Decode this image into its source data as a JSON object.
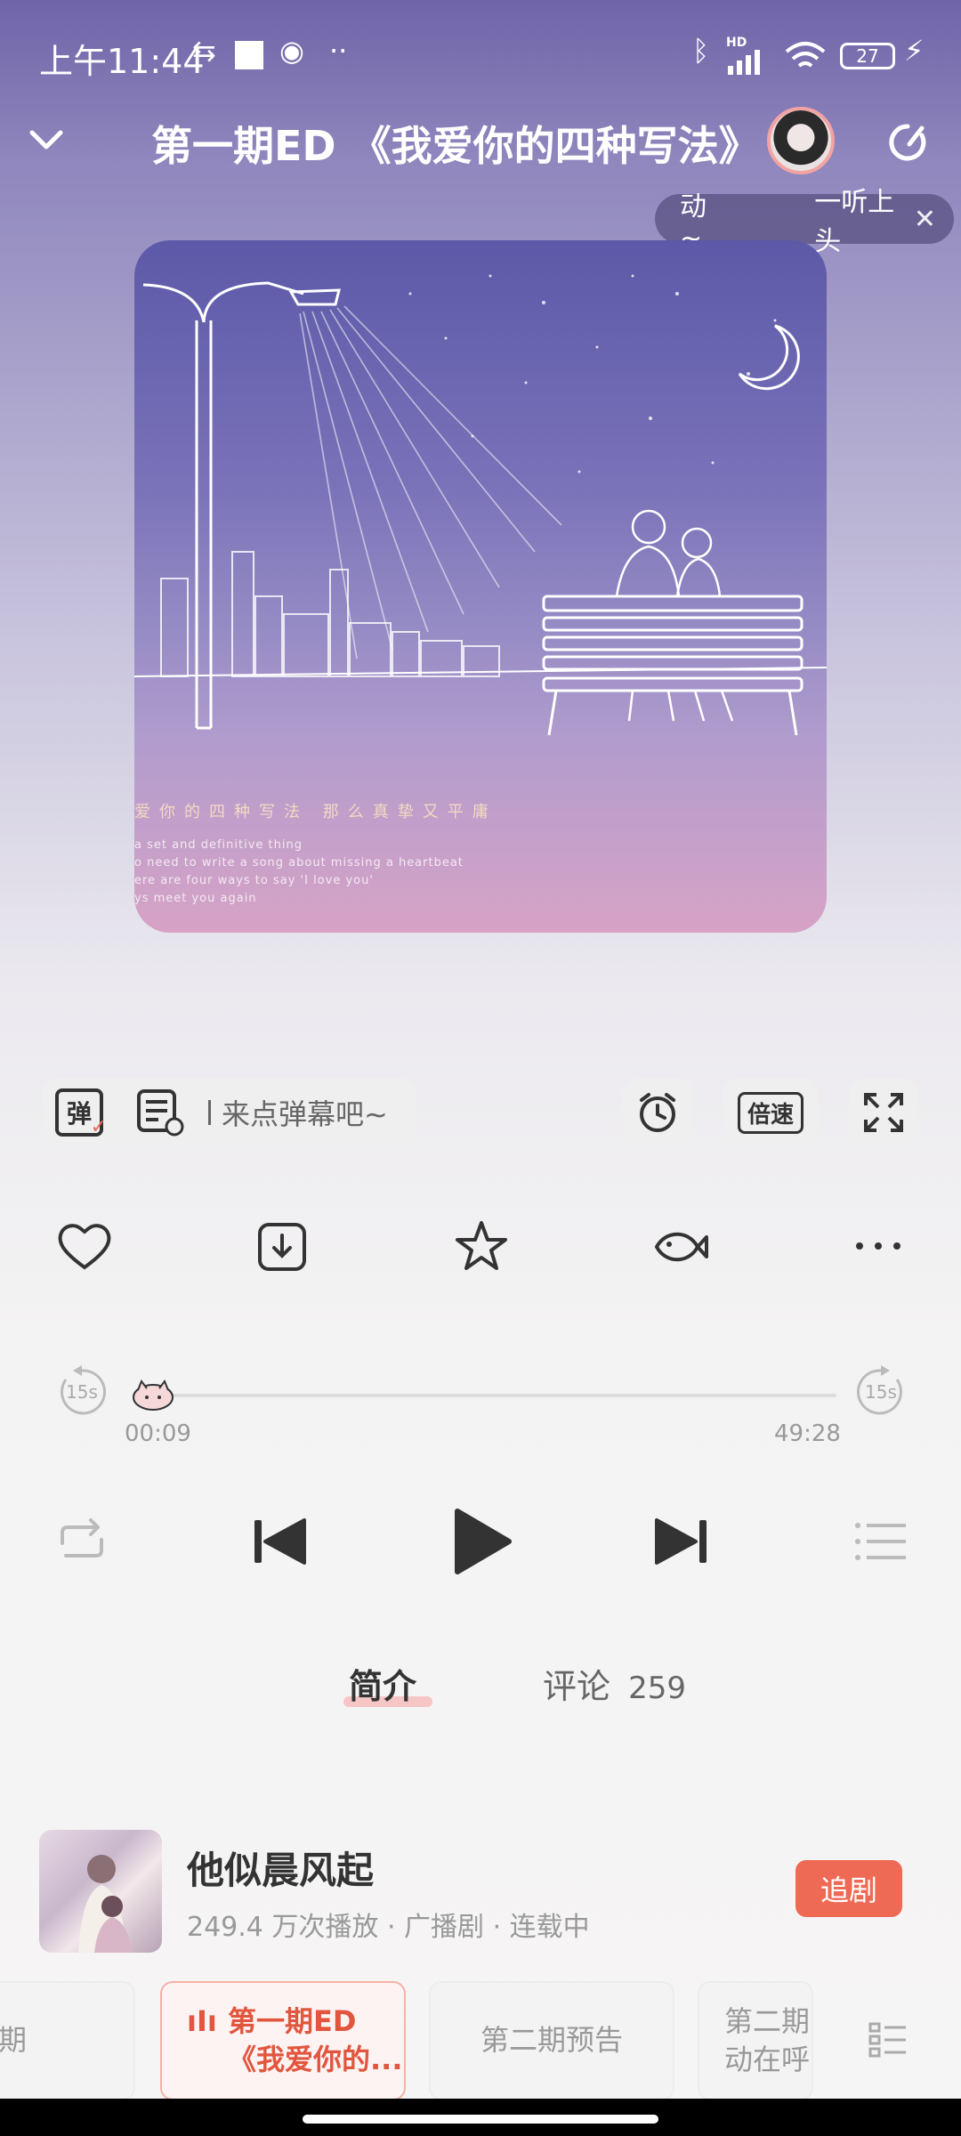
{
  "status_bar": {
    "time": "上午11:44",
    "battery": "27",
    "network_badge": "HD"
  },
  "header": {
    "title": "第一期ED 《我爱你的四种写法》"
  },
  "tooltip": {
    "text_left": "动~",
    "text_right": "一听上头",
    "close": "✕"
  },
  "cover": {
    "title_line": "爱你的四种写法 那么真挚又平庸",
    "lines": [
      "a set and definitive thing",
      "o need to write a song about missing a heartbeat",
      "ere are four ways to say 'I love you'",
      "ys meet you again"
    ]
  },
  "controls": {
    "danmu_label": "弹",
    "danmu_placeholder": "来点弹幕吧~",
    "speed_label": "倍速"
  },
  "progress": {
    "current": "00:09",
    "total": "49:28",
    "fraction": 0.003,
    "skip_back": "15s",
    "skip_forward": "15s"
  },
  "tabs": [
    {
      "label": "简介",
      "count": ""
    },
    {
      "label": "评论",
      "count": "259"
    }
  ],
  "album": {
    "title": "他似晨风起",
    "meta": "249.4 万次播放 · 广播剧 · 连载中",
    "follow_label": "追剧"
  },
  "episodes": [
    {
      "label": "期"
    },
    {
      "label": "第一期ED\n《我爱你的..."
    },
    {
      "label": "第二期预告"
    },
    {
      "label": "第二期\n动在呼"
    }
  ],
  "colors": {
    "accent": "#ef6a55",
    "active_episode": "#e2563f"
  }
}
